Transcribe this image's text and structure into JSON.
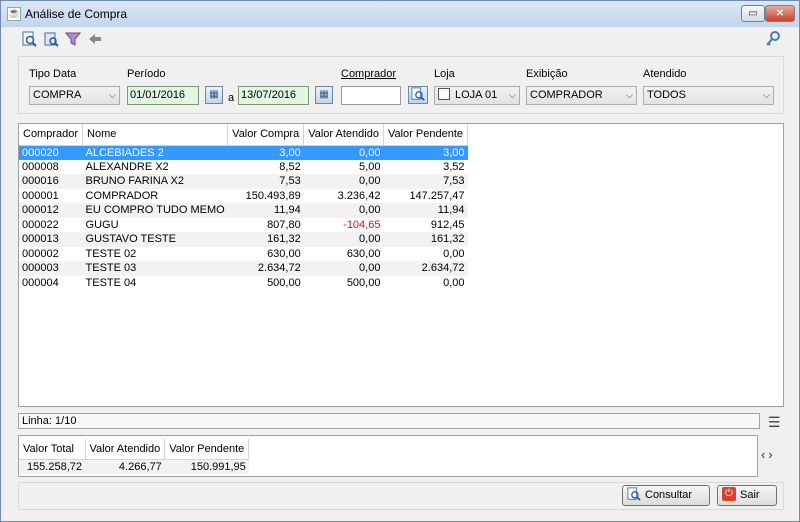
{
  "window": {
    "title": "Análise de Compra",
    "app_icon": "app-icon",
    "controls": {
      "minimize": "▭",
      "close": "✕"
    }
  },
  "toolbar": {
    "icons": [
      "search-document-icon",
      "print-preview-icon",
      "filter-funnel-icon",
      "back-arrow-icon",
      "key-icon"
    ]
  },
  "filters": {
    "tipo_data": {
      "label": "Tipo Data",
      "value": "COMPRA"
    },
    "periodo": {
      "label": "Período",
      "from": "01/01/2016",
      "separator": "a",
      "to": "13/07/2016"
    },
    "comprador": {
      "label": "Comprador",
      "value": ""
    },
    "loja": {
      "label": "Loja",
      "value": "LOJA 01",
      "checked": false
    },
    "exibicao": {
      "label": "Exibição",
      "value": "COMPRADOR"
    },
    "atendido": {
      "label": "Atendido",
      "value": "TODOS"
    }
  },
  "grid": {
    "columns": [
      "Comprador",
      "Nome",
      "Valor Compra",
      "Valor Atendido",
      "Valor Pendente"
    ],
    "rows": [
      [
        "000020",
        "ALCEBIADES 2",
        "3,00",
        "0,00",
        "3,00"
      ],
      [
        "000008",
        "ALEXANDRE X2",
        "8,52",
        "5,00",
        "3,52"
      ],
      [
        "000016",
        "BRUNO FARINA X2",
        "7,53",
        "0,00",
        "7,53"
      ],
      [
        "000001",
        "COMPRADOR",
        "150.493,89",
        "3.236,42",
        "147.257,47"
      ],
      [
        "000012",
        "EU COMPRO TUDO MEMO",
        "11,94",
        "0,00",
        "11,94"
      ],
      [
        "000022",
        "GUGU",
        "807,80",
        "-104,65",
        "912,45"
      ],
      [
        "000013",
        "GUSTAVO TESTE",
        "161,32",
        "0,00",
        "161,32"
      ],
      [
        "000002",
        "TESTE 02",
        "630,00",
        "630,00",
        "0,00"
      ],
      [
        "000003",
        "TESTE 03",
        "2.634,72",
        "0,00",
        "2.634,72"
      ],
      [
        "000004",
        "TESTE 04",
        "500,00",
        "500,00",
        "0,00"
      ]
    ],
    "selected_row": 0
  },
  "status": {
    "linha": "Linha: 1/10"
  },
  "totals": {
    "columns": [
      "Valor Total",
      "Valor Atendido",
      "Valor Pendente"
    ],
    "values": [
      "155.258,72",
      "4.266,77",
      "150.991,95"
    ]
  },
  "buttons": {
    "consultar": "Consultar",
    "sair": "Sair"
  },
  "colors": {
    "selection": "#3399ff",
    "negative": "#e01010",
    "date_field_bg": "#e3f5e3"
  }
}
